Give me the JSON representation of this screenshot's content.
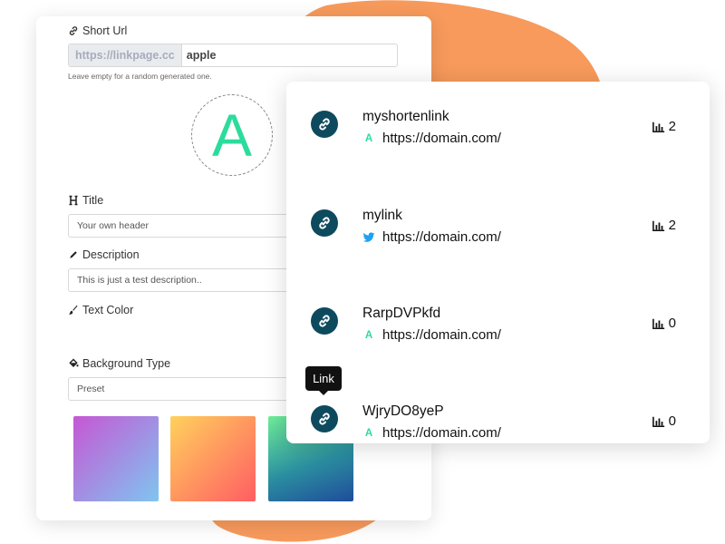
{
  "colors": {
    "accent_blob": "#f79a5c",
    "link_button": "#0d4a5e",
    "brand_green": "#2bdc9c",
    "twitter_blue": "#1da1f2"
  },
  "form": {
    "short_url": {
      "label": "Short Url",
      "prefix": "https://linkpage.cc",
      "value": "apple",
      "hint": "Leave empty for a random generated one."
    },
    "avatar_letter": "A",
    "title": {
      "label": "Title",
      "value": "Your own header"
    },
    "description": {
      "label": "Description",
      "value": "This is just a test description.."
    },
    "text_color": {
      "label": "Text Color"
    },
    "background_type": {
      "label": "Background Type",
      "value": "Preset"
    },
    "swatches": [
      "purple-blue gradient",
      "yellow-red gradient",
      "green-blue gradient"
    ]
  },
  "links": [
    {
      "name": "myshortenlink",
      "url": "https://domain.com/",
      "source_icon": "brand-a",
      "source_text": "A",
      "clicks": "2"
    },
    {
      "name": "mylink",
      "url": "https://domain.com/",
      "source_icon": "twitter-icon",
      "source_text": "",
      "clicks": "2"
    },
    {
      "name": "RarpDVPkfd",
      "url": "https://domain.com/",
      "source_icon": "brand-a",
      "source_text": "A",
      "clicks": "0"
    },
    {
      "name": "WjryDO8yeP",
      "url": "https://domain.com/",
      "source_icon": "brand-a",
      "source_text": "A",
      "clicks": "0"
    }
  ],
  "tooltip": {
    "text": "Link"
  }
}
